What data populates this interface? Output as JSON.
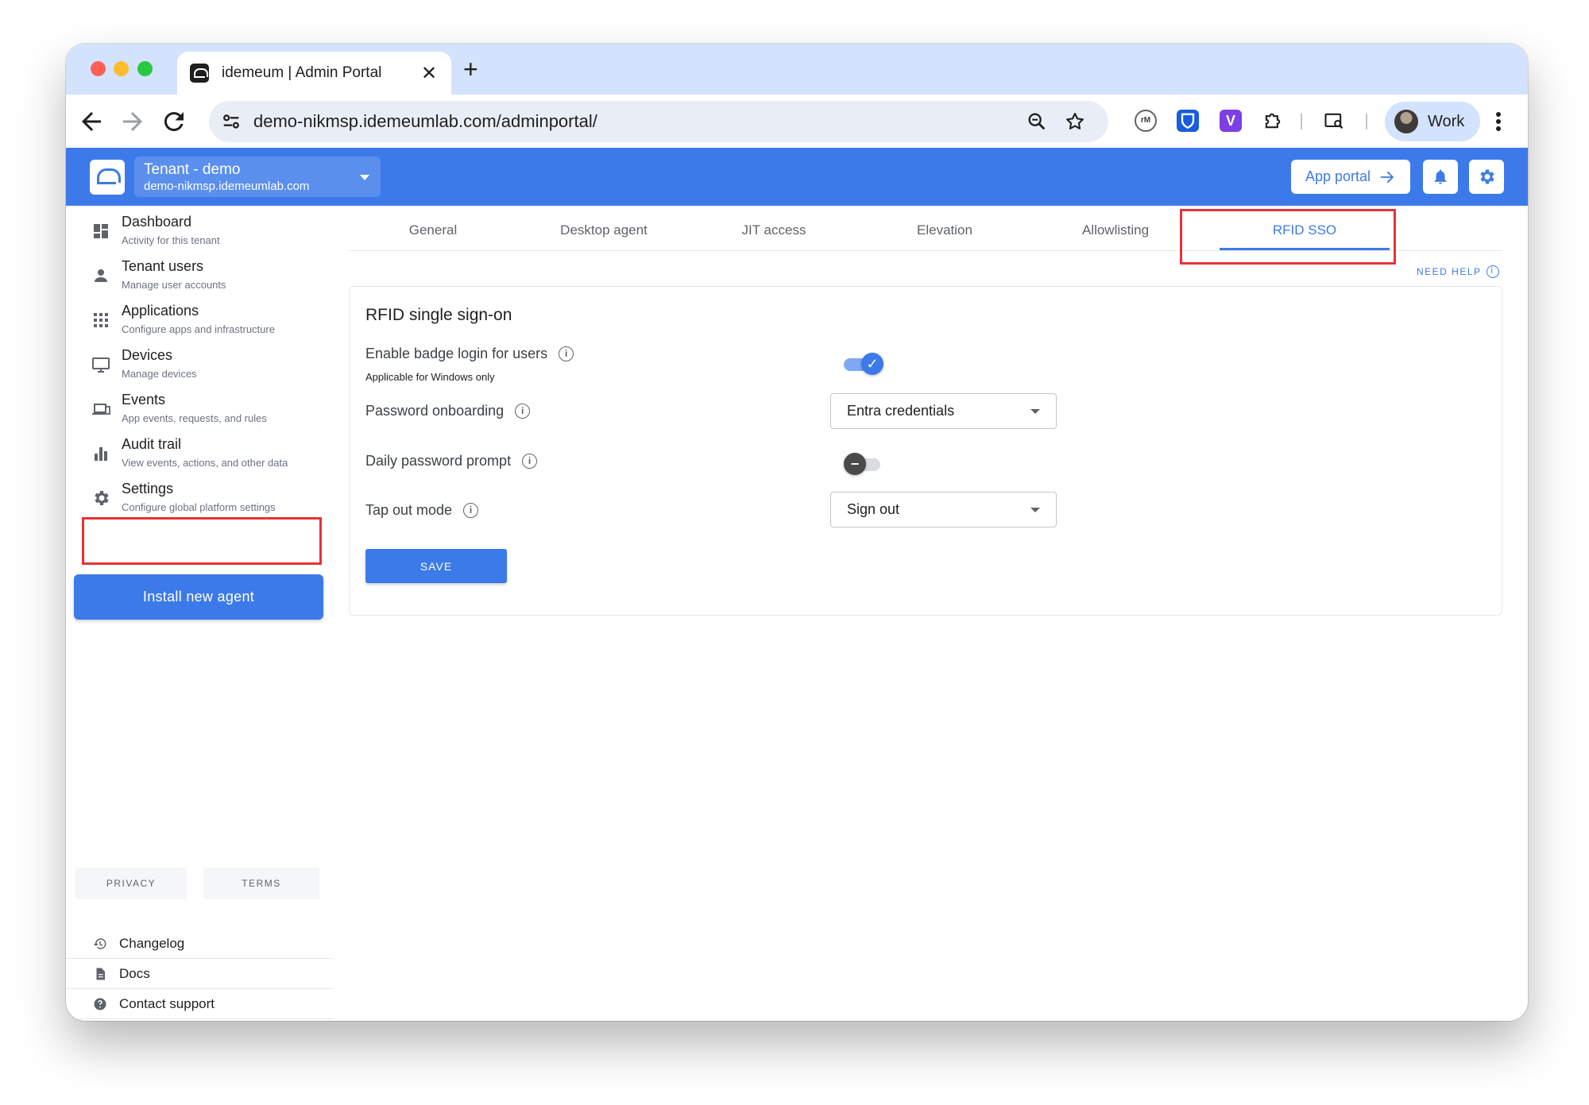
{
  "browser": {
    "tab_title": "idemeum | Admin Portal",
    "close_glyph": "✕",
    "newtab_glyph": "+",
    "url": "demo-nikmsp.idemeumlab.com/adminportal/",
    "profile_name": "Work",
    "extensions": [
      "cm-icon",
      "bitwarden-icon",
      "v-icon",
      "puzzle-icon",
      "tab-search-icon"
    ],
    "ext_cm_label": "rM",
    "ext_v_label": "V"
  },
  "header": {
    "tenant_name": "Tenant - demo",
    "tenant_domain": "demo-nikmsp.idemeumlab.com",
    "app_portal_label": "App portal",
    "accent_color": "#3c7ae9"
  },
  "sidebar": {
    "items": [
      {
        "title": "Dashboard",
        "subtitle": "Activity for this tenant",
        "icon": "dashboard-icon"
      },
      {
        "title": "Tenant users",
        "subtitle": "Manage user accounts",
        "icon": "person-icon"
      },
      {
        "title": "Applications",
        "subtitle": "Configure apps and infrastructure",
        "icon": "apps-grid-icon"
      },
      {
        "title": "Devices",
        "subtitle": "Manage devices",
        "icon": "monitor-icon"
      },
      {
        "title": "Events",
        "subtitle": "App events, requests, and rules",
        "icon": "devices-icon"
      },
      {
        "title": "Audit trail",
        "subtitle": "View events, actions, and other data",
        "icon": "bar-chart-icon"
      },
      {
        "title": "Settings",
        "subtitle": "Configure global platform settings",
        "icon": "gear-icon"
      }
    ],
    "install_label": "Install new agent",
    "bottom_links": [
      {
        "label": "Changelog",
        "icon": "history-icon"
      },
      {
        "label": "Docs",
        "icon": "document-icon"
      },
      {
        "label": "Contact support",
        "icon": "help-icon"
      }
    ],
    "privacy_label": "PRIVACY",
    "terms_label": "TERMS"
  },
  "settings_tabs": [
    "General",
    "Desktop agent",
    "JIT access",
    "Elevation",
    "Allowlisting",
    "RFID SSO"
  ],
  "active_tab": "RFID SSO",
  "need_help_label": "NEED HELP",
  "rfid": {
    "title": "RFID single sign-on",
    "badge_login_label": "Enable badge login for users",
    "badge_login_sub": "Applicable for Windows only",
    "badge_login_enabled": true,
    "password_onboarding_label": "Password onboarding",
    "password_onboarding_value": "Entra credentials",
    "daily_prompt_label": "Daily password prompt",
    "daily_prompt_enabled": false,
    "tap_out_label": "Tap out mode",
    "tap_out_value": "Sign out",
    "save_label": "SAVE",
    "info_glyph": "i",
    "check_glyph": "✓",
    "minus_glyph": "−"
  }
}
